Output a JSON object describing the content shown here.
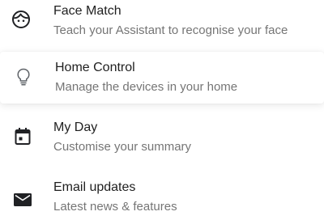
{
  "settings": {
    "items": [
      {
        "id": "face-match",
        "icon": "face-icon",
        "title": "Face Match",
        "subtitle": "Teach your Assistant to recognise your face"
      },
      {
        "id": "home-control",
        "icon": "lightbulb-icon",
        "title": "Home Control",
        "subtitle": "Manage the devices in your home"
      },
      {
        "id": "my-day",
        "icon": "calendar-icon",
        "title": "My Day",
        "subtitle": "Customise your summary"
      },
      {
        "id": "email-updates",
        "icon": "mail-icon",
        "title": "Email updates",
        "subtitle": "Latest news & features"
      }
    ]
  },
  "colors": {
    "title": "#1f1f1f",
    "subtitle": "#757575",
    "icon": "#202124",
    "icon_outline_light": "#5f6368"
  }
}
